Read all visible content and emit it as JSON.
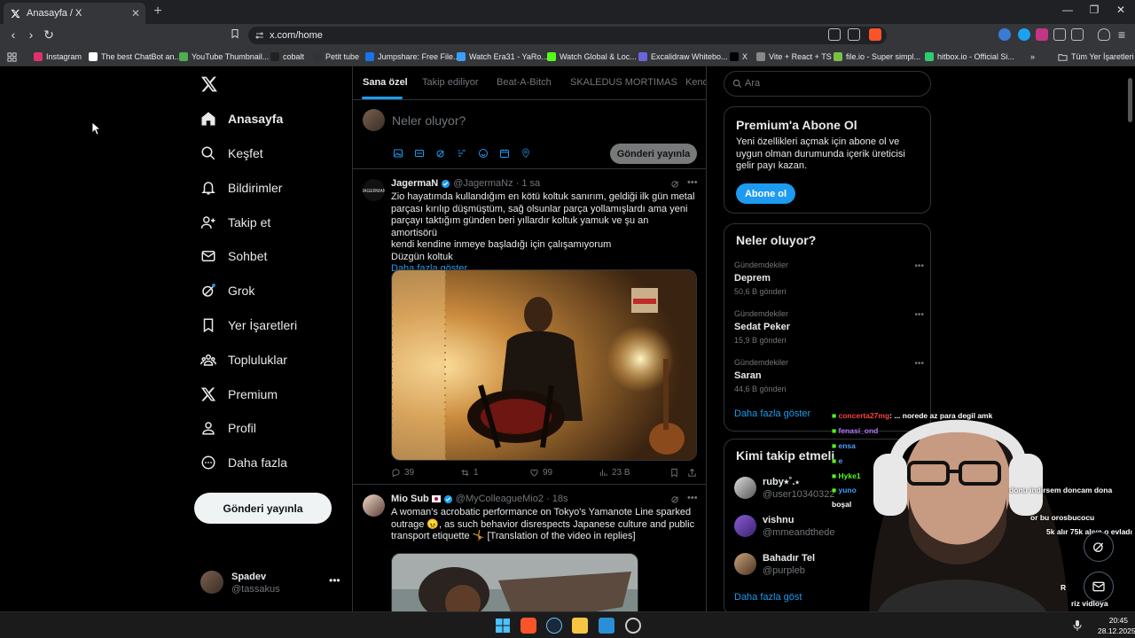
{
  "browser": {
    "tab_title": "Anasayfa / X",
    "url": "x.com/home",
    "bookmarks": [
      {
        "label": "Instagram",
        "color": "#e1306c"
      },
      {
        "label": "The best ChatBot an...",
        "color": "#ffffff"
      },
      {
        "label": "YouTube Thumbnail...",
        "color": "#4caf50"
      },
      {
        "label": "cobalt",
        "color": "#222222"
      },
      {
        "label": "Petit tube",
        "color": "#333333"
      },
      {
        "label": "Jumpshare: Free File...",
        "color": "#1a73e8"
      },
      {
        "label": "Watch Era31 - YaRo...",
        "color": "#3aa0ff"
      },
      {
        "label": "Watch Global & Loc...",
        "color": "#53fc18"
      },
      {
        "label": "Excalidraw Whitebo...",
        "color": "#6965db"
      },
      {
        "label": "X",
        "color": "#000000"
      },
      {
        "label": "Vite + React + TS",
        "color": "#888888"
      },
      {
        "label": "file.io - Super simpl...",
        "color": "#7bc043"
      },
      {
        "label": "hitbox.io - Official Si...",
        "color": "#2ecc71"
      }
    ],
    "bookmarks_folder": "Tüm Yer İşaretleri"
  },
  "nav": {
    "items": [
      {
        "label": "Anasayfa",
        "icon": "home-icon"
      },
      {
        "label": "Keşfet",
        "icon": "search-icon"
      },
      {
        "label": "Bildirimler",
        "icon": "bell-icon"
      },
      {
        "label": "Takip et",
        "icon": "add-person-icon"
      },
      {
        "label": "Sohbet",
        "icon": "mail-icon"
      },
      {
        "label": "Grok",
        "icon": "grok-icon"
      },
      {
        "label": "Yer İşaretleri",
        "icon": "bookmark-icon"
      },
      {
        "label": "Topluluklar",
        "icon": "communities-icon"
      },
      {
        "label": "Premium",
        "icon": "x-icon"
      },
      {
        "label": "Profil",
        "icon": "person-icon"
      },
      {
        "label": "Daha fazla",
        "icon": "more-circle-icon"
      }
    ],
    "post_button": "Gönderi yayınla",
    "profile": {
      "name": "Spadev",
      "handle": "@tassakus"
    }
  },
  "feed": {
    "tabs": [
      "Sana özel",
      "Takip ediliyor",
      "Beat-A-Bitch",
      "SKALEDUS MORTIMAS",
      "Kend"
    ],
    "composer": {
      "placeholder": "Neler oluyor?",
      "button": "Gönderi yayınla"
    },
    "posts": [
      {
        "name": "JagermaN",
        "handle": "@JagermaNz",
        "time": "· 1 sa",
        "lines": [
          "Zio hayatımda kullandığım en kötü koltuk sanırım, geldiği ilk gün metal",
          "parçası kırılıp düşmüştüm, sağ olsunlar parça yollamışlardı ama yeni",
          "parçayı taktığım günden beri yıllardır koltuk yamuk ve şu an amortisörü",
          "kendi kendine inmeye başladığı için çalışamıyorum",
          "Düzgün koltuk"
        ],
        "show_more": "Daha fazla göster",
        "stats": {
          "replies": "39",
          "reposts": "1",
          "likes": "99",
          "views": "23 B"
        }
      },
      {
        "name": "Mio Sub",
        "handle": "@MyColleagueMio2",
        "time": "· 18s",
        "lines": [
          "A woman's acrobatic performance on Tokyo's Yamanote Line sparked",
          "outrage 😠, as such behavior disrespects Japanese culture and public",
          "transport etiquette 🤸 [Translation of the video in replies]"
        ]
      }
    ]
  },
  "sidebar": {
    "search_placeholder": "Ara",
    "premium": {
      "title": "Premium'a Abone Ol",
      "text": "Yeni özellikleri açmak için abone ol ve uygun olman durumunda içerik üreticisi gelir payı kazan.",
      "button": "Abone ol"
    },
    "trends": {
      "title": "Neler oluyor?",
      "items": [
        {
          "category": "Gündemdekiler",
          "name": "Deprem",
          "count": "50,6 B gönderi"
        },
        {
          "category": "Gündemdekiler",
          "name": "Sedat Peker",
          "count": "15,9 B gönderi"
        },
        {
          "category": "Gündemdekiler",
          "name": "Saran",
          "count": "44,6 B gönderi"
        }
      ],
      "more": "Daha fazla göster"
    },
    "who_to_follow": {
      "title": "Kimi takip etmeli",
      "items": [
        {
          "name": "ruby⭑˚.⋆",
          "handle": "@user10340322"
        },
        {
          "name": "vishnu",
          "handle": "@mmeandthede"
        },
        {
          "name": "Bahadır Tel",
          "handle": "@purpleb"
        }
      ],
      "more": "Daha fazla göst"
    }
  },
  "stream_chat": [
    {
      "user": "concerta27mg",
      "text": ": ... norede az para degil amk",
      "color": "#ff4040"
    },
    {
      "user": "fenasi_ond",
      "text": "",
      "color": "#b57bff"
    },
    {
      "user": "ensa",
      "text": "",
      "color": "#4aa3ff"
    },
    {
      "user": "e",
      "text": "",
      "color": "#4aa3ff"
    },
    {
      "user": "Hyke1",
      "text": "",
      "color": "#53fc18"
    },
    {
      "user": "yuno",
      "text": "",
      "color": "#3aa0ff"
    },
    {
      "user": "",
      "text": "donu indirsem doncam dona",
      "color": "#ffffff"
    },
    {
      "user": "",
      "text": "boşal",
      "color": "#ffffff"
    },
    {
      "user": "",
      "text": "or bu orosbucocu",
      "color": "#ffffff"
    },
    {
      "user": "",
      "text": "5k alır 75k alıyo o evladı",
      "color": "#ffffff"
    },
    {
      "user": "",
      "text": "R",
      "color": "#ffffff"
    },
    {
      "user": "",
      "text": "riz vidloya",
      "color": "#ffffff"
    }
  ],
  "taskbar": {
    "time": "20:45",
    "date": "28.12.2025"
  }
}
